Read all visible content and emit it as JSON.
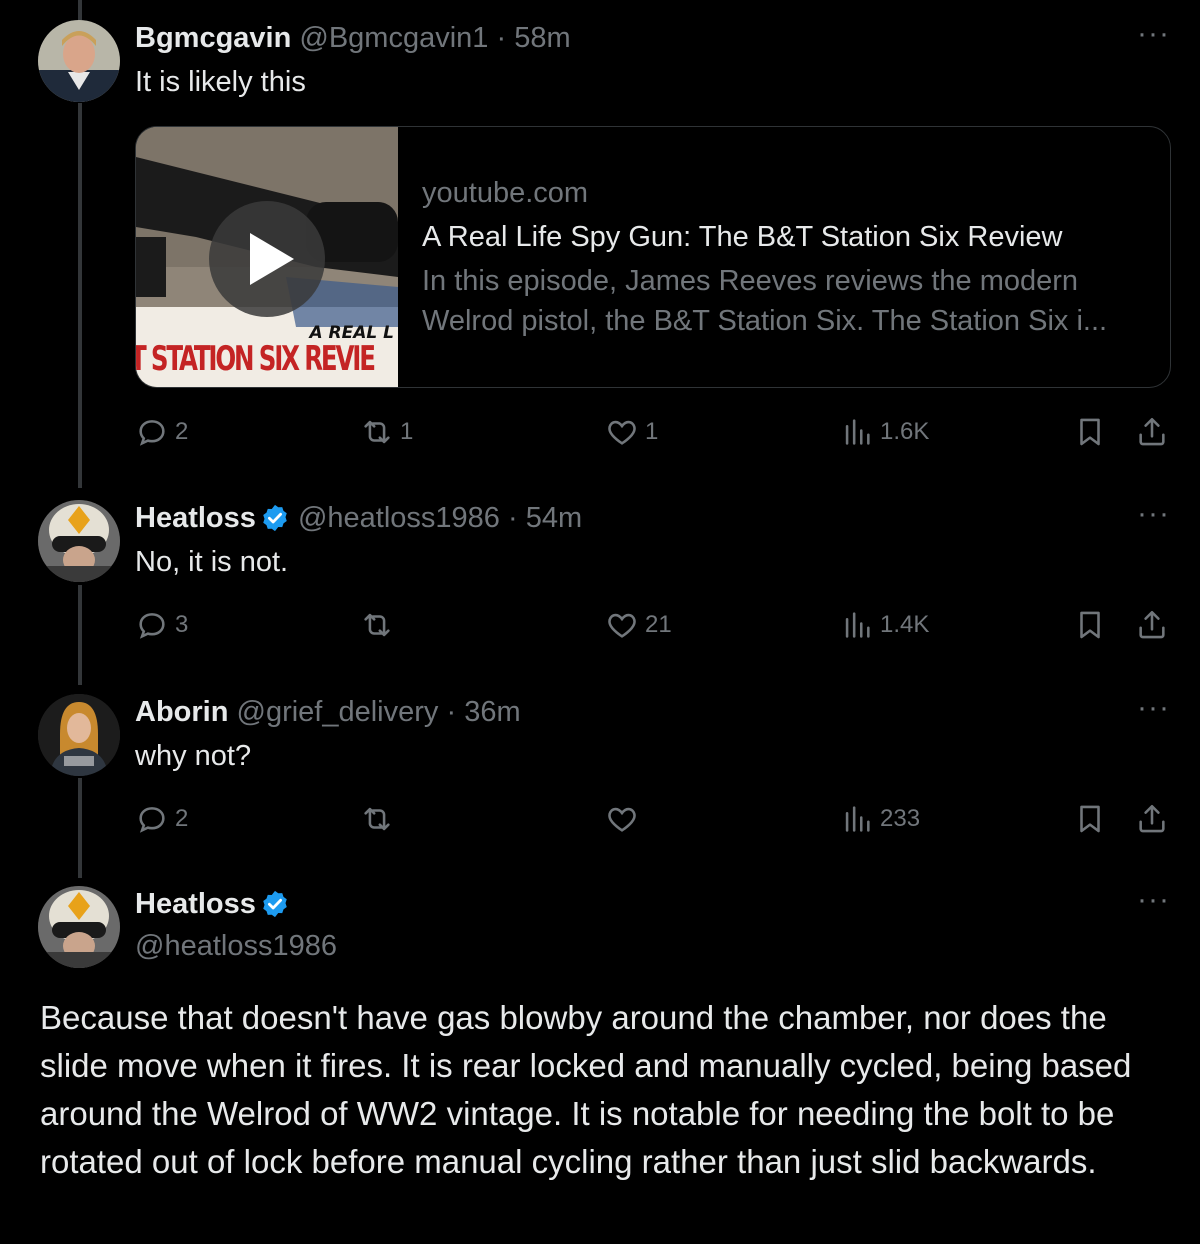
{
  "posts": [
    {
      "name": "Bgmcgavin",
      "handle": "@Bgmcgavin1",
      "time": "· 58m",
      "text": "It is likely this",
      "more": "···",
      "card": {
        "domain": "youtube.com",
        "title": "A Real Life Spy Gun: The B&T Station Six Review",
        "description": "In this episode, James Reeves reviews the modern Welrod pistol, the B&T Station Six. The Station Six i...",
        "thumb_text_small": "A REAL L",
        "thumb_text_big": "T STATION SIX REVIE"
      },
      "stats": {
        "replies": "2",
        "reposts": "1",
        "likes": "1",
        "views": "1.6K"
      }
    },
    {
      "name": "Heatloss",
      "handle": "@heatloss1986",
      "time": "· 54m",
      "text": "No, it is not.",
      "more": "···",
      "stats": {
        "replies": "3",
        "reposts": "",
        "likes": "21",
        "views": "1.4K"
      }
    },
    {
      "name": "Aborin",
      "handle": "@grief_delivery",
      "time": "· 36m",
      "text": "why not?",
      "more": "···",
      "stats": {
        "replies": "2",
        "reposts": "",
        "likes": "",
        "views": "233"
      }
    },
    {
      "name": "Heatloss",
      "handle": "@heatloss1986",
      "more": "···",
      "text": "Because that doesn't have gas blowby around the chamber, nor does the slide move when it fires. It is rear locked and manually cycled, being based around the Welrod of WW2 vintage. It is notable for needing the bolt to be rotated out of lock before manual cycling rather than just slid backwards."
    }
  ],
  "colors": {
    "background": "#000000",
    "text_primary": "#e7e9ea",
    "text_secondary": "#71767b",
    "verified": "#1d9bf0",
    "thread_line": "#333639",
    "card_border": "#2f3336"
  },
  "icons": [
    "reply-icon",
    "repost-icon",
    "like-icon",
    "views-icon",
    "bookmark-icon",
    "share-icon",
    "verified-badge-icon",
    "play-icon",
    "more-icon"
  ]
}
